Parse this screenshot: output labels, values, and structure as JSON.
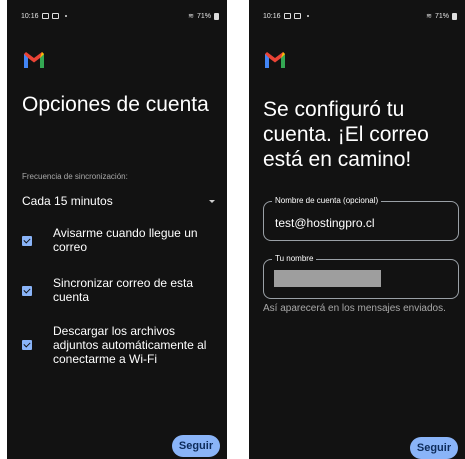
{
  "left_screen": {
    "status": {
      "time": "10:16",
      "battery": "71%"
    },
    "title": "Opciones de cuenta",
    "sync_label": "Frecuencia de sincronización:",
    "sync_value": "Cada 15 minutos",
    "checkboxes": [
      {
        "label": "Avisarme cuando llegue un correo",
        "checked": true
      },
      {
        "label": "Sincronizar correo de esta cuenta",
        "checked": true
      },
      {
        "label": "Descargar los archivos adjuntos automáticamente al conectarme a Wi-Fi",
        "checked": true
      }
    ],
    "next_button": "Seguir"
  },
  "right_screen": {
    "status": {
      "time": "10:16",
      "battery": "71%"
    },
    "title": "Se configuró tu cuenta. ¡El correo está en camino!",
    "account_name_label": "Nombre de cuenta (opcional)",
    "account_name_value": "test@hostingpro.cl",
    "your_name_label": "Tu nombre",
    "your_name_value": "",
    "helper_text": "Así aparecerá en los mensajes enviados.",
    "next_button": "Seguir"
  },
  "colors": {
    "background": "#121212",
    "accent": "#8ab4f8",
    "gmail_red": "#ea4335"
  },
  "icons": [
    "gmail-logo",
    "dropdown-caret",
    "checkbox-checked"
  ]
}
